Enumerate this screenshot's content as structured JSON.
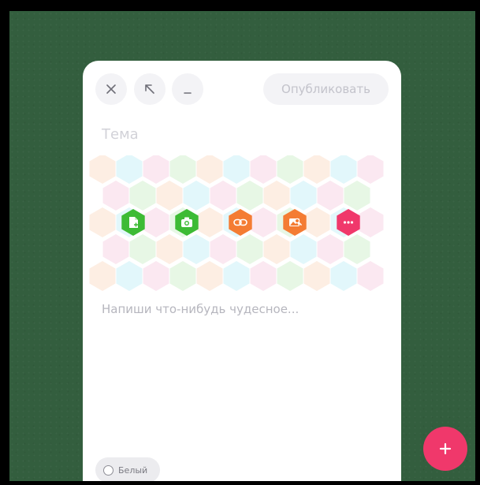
{
  "toolbar": {
    "close_icon": "close-icon",
    "expand_icon": "arrow-up-left-icon",
    "minimize_icon": "minimize-icon",
    "publish_label": "Опубликовать"
  },
  "editor": {
    "title_placeholder": "Тема",
    "body_placeholder": "Напиши что-нибудь чудесное..."
  },
  "attachments": [
    {
      "name": "attach-file",
      "icon": "file-icon",
      "color": "#3dbb35"
    },
    {
      "name": "attach-photo",
      "icon": "camera-icon",
      "color": "#3dbb35"
    },
    {
      "name": "attach-link",
      "icon": "link-icon",
      "color": "#f47c33"
    },
    {
      "name": "attach-image-search",
      "icon": "image-search-icon",
      "color": "#f47c33"
    },
    {
      "name": "attach-more",
      "icon": "more-icon",
      "color": "#f0386b"
    }
  ],
  "honeycomb_colors": [
    "#fdeee3",
    "#e2f7fb",
    "#fbe8f1",
    "#e7f7e5"
  ],
  "theme": {
    "label": "Белый"
  },
  "fab": {
    "icon": "plus-icon",
    "color": "#f0386b"
  }
}
